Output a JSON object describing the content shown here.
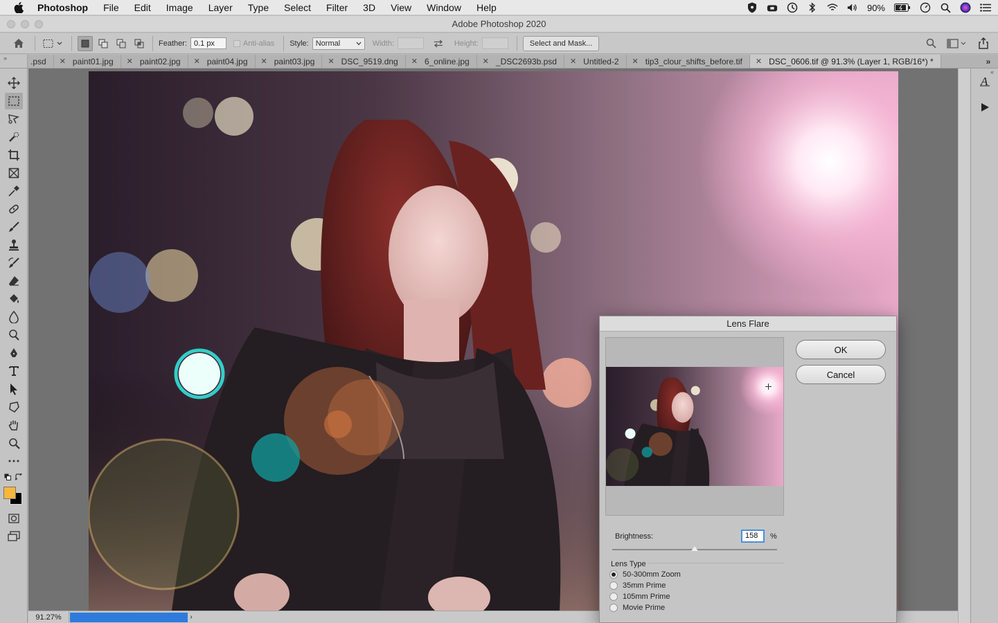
{
  "menubar": {
    "app_name": "Photoshop",
    "items": [
      "File",
      "Edit",
      "Image",
      "Layer",
      "Type",
      "Select",
      "Filter",
      "3D",
      "View",
      "Window",
      "Help"
    ],
    "battery": "90%"
  },
  "window": {
    "title": "Adobe Photoshop 2020"
  },
  "options": {
    "feather_label": "Feather:",
    "feather_value": "0.1 px",
    "antialias_label": "Anti-alias",
    "style_label": "Style:",
    "style_value": "Normal",
    "width_label": "Width:",
    "height_label": "Height:",
    "select_mask_label": "Select and Mask..."
  },
  "tabs": [
    {
      "label": ".psd",
      "active": false
    },
    {
      "label": "paint01.jpg",
      "active": false
    },
    {
      "label": "paint02.jpg",
      "active": false
    },
    {
      "label": "paint04.jpg",
      "active": false
    },
    {
      "label": "paint03.jpg",
      "active": false
    },
    {
      "label": "DSC_9519.dng",
      "active": false
    },
    {
      "label": "6_online.jpg",
      "active": false
    },
    {
      "label": "_DSC2693b.psd",
      "active": false
    },
    {
      "label": "Untitled-2",
      "active": false
    },
    {
      "label": "tip3_clour_shifts_before.tif",
      "active": false
    },
    {
      "label": "DSC_0606.tif @ 91.3% (Layer 1, RGB/16*) *",
      "active": true
    }
  ],
  "toolbox": {
    "tools": [
      "move-tool",
      "rectangular-marquee-tool",
      "lasso-tool",
      "quick-selection-tool",
      "crop-tool",
      "frame-tool",
      "eyedropper-tool",
      "healing-brush-tool",
      "brush-tool",
      "clone-stamp-tool",
      "history-brush-tool",
      "eraser-tool",
      "paint-bucket-tool",
      "blur-tool",
      "dodge-tool",
      "pen-tool",
      "type-tool",
      "path-selection-tool",
      "custom-shape-tool",
      "hand-tool",
      "zoom-tool",
      "edit-toolbar"
    ],
    "foreground_color": "#f5b73e",
    "background_color": "#000000"
  },
  "statusbar": {
    "zoom": "91.27%"
  },
  "dialog": {
    "title": "Lens Flare",
    "ok_label": "OK",
    "cancel_label": "Cancel",
    "brightness_label": "Brightness:",
    "brightness_value": "158",
    "brightness_unit": "%",
    "brightness_slider_fraction": 0.5,
    "lens_type_label": "Lens Type",
    "lens_types": [
      {
        "label": "50-300mm Zoom",
        "selected": true
      },
      {
        "label": "35mm Prime",
        "selected": false
      },
      {
        "label": "105mm Prime",
        "selected": false
      },
      {
        "label": "Movie Prime",
        "selected": false
      }
    ]
  },
  "colors": {
    "accent": "#2e7bdb",
    "field_focus": "#4c8fe0"
  }
}
